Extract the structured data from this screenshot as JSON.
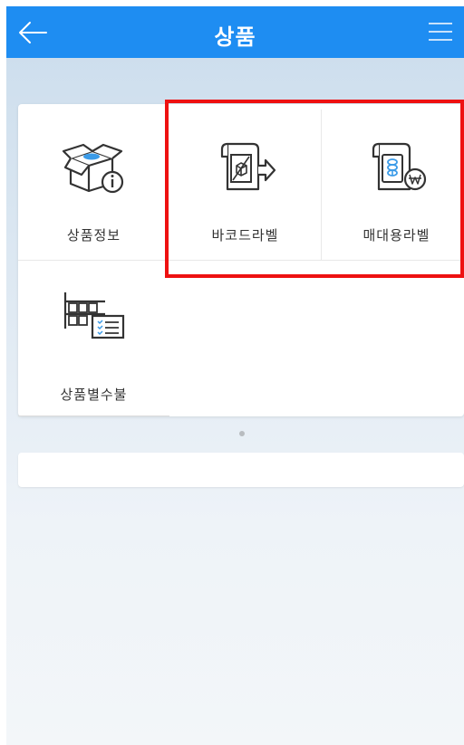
{
  "header": {
    "title": "상품",
    "back_icon": "arrow-left-icon",
    "menu_icon": "hamburger-menu-icon",
    "color": "#1e8df2"
  },
  "menu": {
    "items": [
      {
        "label": "상품정보",
        "icon": "open-box-info-icon"
      },
      {
        "label": "바코드라벨",
        "icon": "barcode-label-print-icon"
      },
      {
        "label": "매대용라벨",
        "icon": "shelf-price-label-icon"
      },
      {
        "label": "상품별수불",
        "icon": "inventory-ledger-icon"
      }
    ]
  },
  "pager": {
    "pages": 1,
    "current": 1
  },
  "highlight_color": "#ee1111"
}
